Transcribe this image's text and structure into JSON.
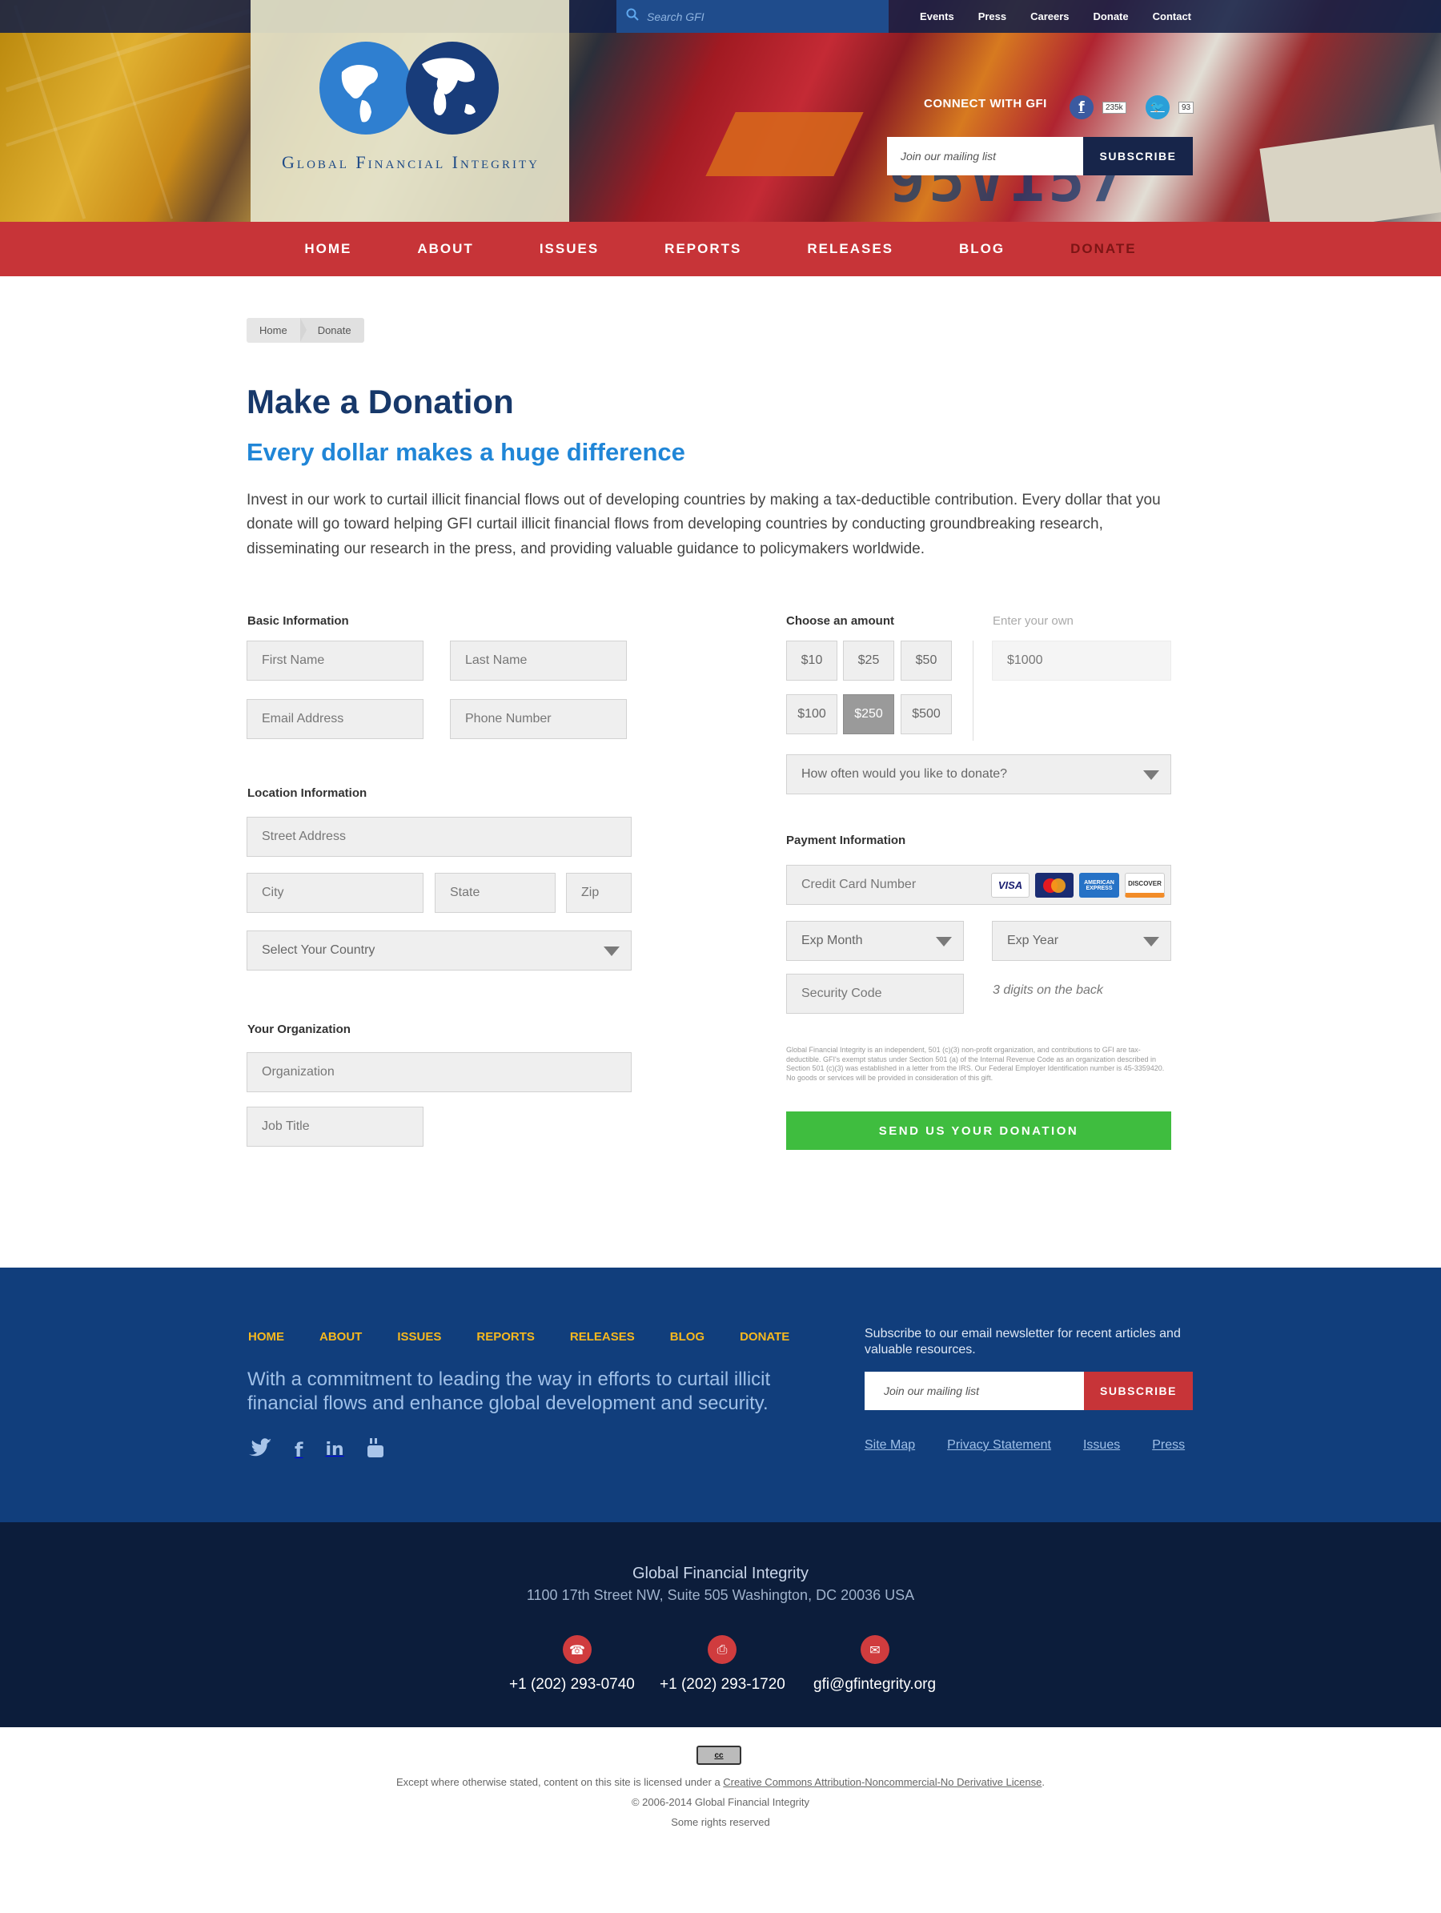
{
  "header": {
    "search_placeholder": "Search GFI",
    "top_links": [
      "Events",
      "Press",
      "Careers",
      "Donate",
      "Contact"
    ],
    "connect_label": "CONNECT WITH GFI",
    "facebook_count": "235k",
    "twitter_count": "93",
    "mailing_placeholder": "Join our mailing list",
    "subscribe_label": "SUBSCRIBE",
    "logo_text": "Global Financial Integrity",
    "hero_number": "95V157"
  },
  "nav": {
    "items": [
      "HOME",
      "ABOUT",
      "ISSUES",
      "REPORTS",
      "RELEASES",
      "BLOG",
      "DONATE"
    ],
    "active": "DONATE"
  },
  "breadcrumb": [
    "Home",
    "Donate"
  ],
  "page": {
    "title": "Make a Donation",
    "subtitle": "Every dollar makes a huge difference",
    "intro": "Invest in our work to curtail illicit financial flows out of developing countries by making a tax-deductible contribution. Every dollar that you donate will go toward helping GFI curtail illicit financial flows from developing countries by conducting groundbreaking research, disseminating our research in the press, and providing valuable guidance to policymakers worldwide."
  },
  "form": {
    "basic_label": "Basic Information",
    "first_name": "First Name",
    "last_name": "Last Name",
    "email": "Email Address",
    "phone": "Phone Number",
    "location_label": "Location Information",
    "street": "Street Address",
    "city": "City",
    "state": "State",
    "zip": "Zip",
    "country": "Select Your Country",
    "org_label": "Your Organization",
    "organization": "Organization",
    "job_title": "Job Title",
    "amount_label": "Choose an amount",
    "own_label": "Enter your own",
    "own_placeholder": "$1000",
    "amounts": [
      "$10",
      "$25",
      "$50",
      "$100",
      "$250",
      "$500"
    ],
    "selected_amount": "$250",
    "frequency": "How often would you like to donate?",
    "payment_label": "Payment Information",
    "card_number": "Credit Card Number",
    "cards": [
      "VISA",
      "MasterCard",
      "AMERICAN EXPRESS",
      "DISCOVER"
    ],
    "exp_month": "Exp Month",
    "exp_year": "Exp Year",
    "security_code": "Security Code",
    "cvv_hint": "3 digits on the back",
    "legal_note": "Global Financial Integrity is an independent, 501 (c)(3) non-profit organization, and contributions to GFI are tax-deductible. GFI's exempt status under Section 501 (a) of the Internal Revenue Code as an organization described in Section 501 (c)(3) was established in a letter from the IRS. Our Federal Employer Identification number is 45-3359420. No goods or services will be provided in consideration of this gift.",
    "submit_label": "SEND US YOUR DONATION"
  },
  "footer": {
    "nav": [
      "HOME",
      "ABOUT",
      "ISSUES",
      "REPORTS",
      "RELEASES",
      "BLOG",
      "DONATE"
    ],
    "tagline": "With a commitment to leading the way in efforts to curtail illicit financial flows and enhance global development and security.",
    "subscribe_text": "Subscribe to our email newsletter for recent articles and valuable resources.",
    "mailing_placeholder": "Join our mailing list",
    "subscribe_label": "SUBSCRIBE",
    "links": [
      "Site Map",
      "Privacy Statement",
      "Issues",
      "Press"
    ],
    "org_name": "Global Financial Integrity",
    "address": "1100 17th Street NW, Suite 505 Washington, DC 20036 USA",
    "phone": "+1 (202) 293-0740",
    "fax": "+1 (202) 293-1720",
    "email": "gfi@gfintegrity.org",
    "cc_badge": "cc",
    "license_prefix": "Except where otherwise stated, content on this site is licensed under a ",
    "license_link": "Creative Commons Attribution-Noncommercial-No Derivative License",
    "license_suffix": ".",
    "copyright": "© 2006-2014 Global Financial Integrity",
    "rights": "Some rights reserved"
  },
  "colors": {
    "navy": "#17386a",
    "accent_blue": "#2086d7",
    "nav_red": "#c73438",
    "donate_green": "#3fbd3f",
    "footer_blue": "#113e7c",
    "footer_dark": "#0c1d3b",
    "footer_nav_gold": "#f7b81e"
  }
}
